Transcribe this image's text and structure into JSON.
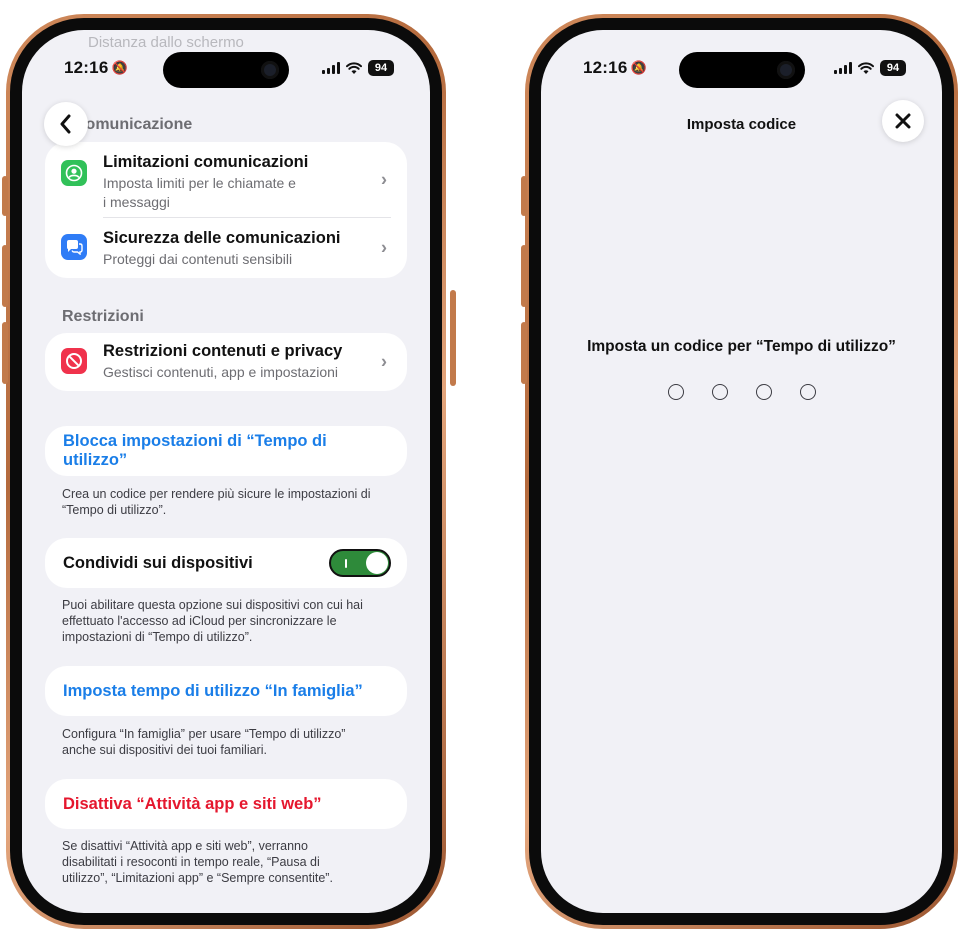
{
  "left_screen": {
    "status": {
      "time": "12:16",
      "battery": "94"
    },
    "scrolled_ghost_text": "Distanza dallo schermo",
    "back_label": "‹",
    "communication": {
      "header": "Comunicazione",
      "items": [
        {
          "title": "Limitazioni comunicazioni",
          "subtitle_line1": "Imposta limiti per le chiamate e",
          "subtitle_line2": "i messaggi",
          "icon": "person-circle-icon",
          "icon_color": "#31c159"
        },
        {
          "title": "Sicurezza delle comunicazioni",
          "subtitle_line1": "Proteggi dai contenuti sensibili",
          "icon": "chat-bubble-icon",
          "icon_color": "#2f7cf6"
        }
      ]
    },
    "restrictions": {
      "header": "Restrizioni",
      "item": {
        "title": "Restrizioni contenuti e privacy",
        "subtitle": "Gestisci contenuti, app e impostazioni",
        "icon": "no-entry-icon",
        "icon_color": "#f0324c"
      }
    },
    "lock": {
      "label": "Blocca impostazioni di “Tempo di utilizzo”",
      "note_line1": "Crea un codice per rendere più sicure le impostazioni di",
      "note_line2": "“Tempo di utilizzo”."
    },
    "share": {
      "label": "Condividi sui dispositivi",
      "enabled": true,
      "note_line1": "Puoi abilitare questa opzione sui dispositivi con cui hai",
      "note_line2": "effettuato l'accesso ad iCloud per sincronizzare le",
      "note_line3": "impostazioni di “Tempo di utilizzo”."
    },
    "family": {
      "label": "Imposta tempo di utilizzo “In famiglia”",
      "note_line1": "Configura “In famiglia” per usare “Tempo di utilizzo”",
      "note_line2": "anche sui dispositivi dei tuoi familiari."
    },
    "disable": {
      "label": "Disattiva “Attività app e siti web”",
      "note_line1": "Se disattivi “Attività app e siti web”, verranno",
      "note_line2": "disabilitati i resoconti in tempo reale, “Pausa di",
      "note_line3": "utilizzo”, “Limitazioni app” e “Sempre consentite”."
    }
  },
  "right_screen": {
    "status": {
      "time": "12:16",
      "battery": "94"
    },
    "title": "Imposta codice",
    "close_label": "✕",
    "prompt": "Imposta un codice per “Tempo di utilizzo”",
    "passcode_length": 4
  },
  "colors": {
    "accent_blue": "#1a7ee8",
    "destructive_red": "#e5172e",
    "toggle_green": "#2e8a3a",
    "frame_copper": "#c27a4b"
  }
}
